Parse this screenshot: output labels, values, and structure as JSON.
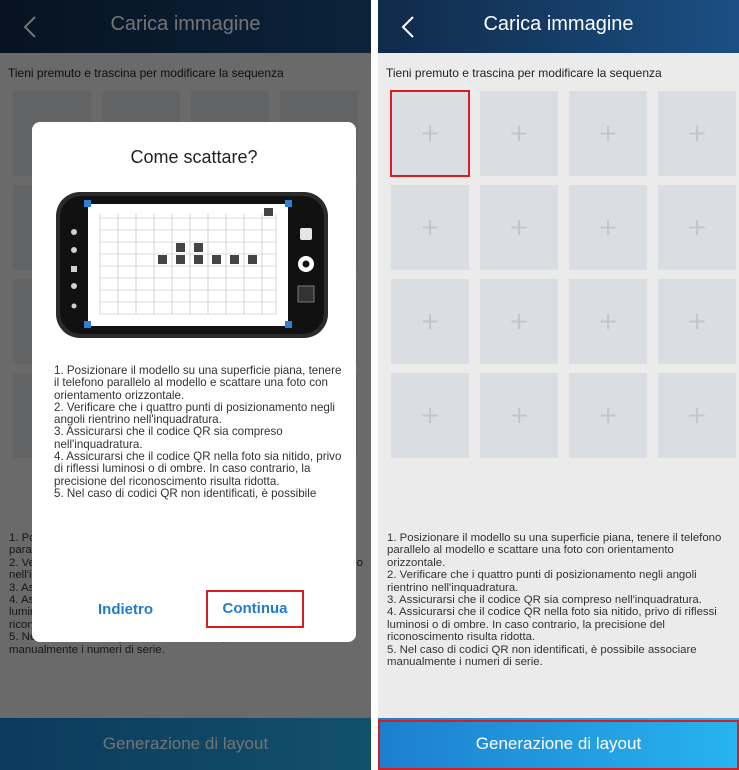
{
  "header": {
    "title": "Carica immagine"
  },
  "hint": "Tieni premuto e trascina per modificare la sequenza",
  "grid": {
    "rows": 4,
    "columns": 4,
    "plus_symbol": "+",
    "highlighted_cell_index": 0
  },
  "instructions": [
    "1. Posizionare il modello su una superficie piana, tenere il telefono parallelo al modello e scattare una foto con orientamento orizzontale.",
    "2. Verificare che i quattro punti di posizionamento negli angoli rientrino nell'inquadratura.",
    "3. Assicurarsi che il codice QR sia compreso nell'inquadratura.",
    "4. Assicurarsi che il codice QR nella foto sia nitido, privo di riflessi luminosi o di ombre. In caso contrario, la precisione del riconoscimento risulta ridotta.",
    "5. Nel caso di codici QR non identificati, è possibile associare manualmente i numeri di serie."
  ],
  "footer": {
    "button_label": "Generazione di layout"
  },
  "dialog": {
    "title": "Come scattare?",
    "steps": [
      "1. Posizionare il modello su una superficie piana, tenere il telefono parallelo al modello e scattare una foto con orientamento orizzontale.",
      "2. Verificare che i quattro punti di posizionamento negli angoli rientrino nell'inquadratura.",
      "3. Assicurarsi che il codice QR sia compreso nell'inquadratura.",
      "4. Assicurarsi che il codice QR nella foto sia nitido, privo di riflessi luminosi o di ombre. In caso contrario, la precisione del riconoscimento risulta ridotta.",
      "5. Nel caso di codici QR non identificati, è possibile"
    ],
    "back_label": "Indietro",
    "continue_label": "Continua"
  },
  "colors": {
    "header_dark": "#102a4a",
    "header_light": "#1b4f83",
    "button_blue": "#1f7dcf",
    "footer_start": "#1c7fd0",
    "footer_end": "#27b4ee",
    "highlight_red": "#d81e1e",
    "cell_gray": "#dadde2"
  },
  "icons": {
    "back": "chevron-left-icon",
    "plus": "plus-icon"
  }
}
